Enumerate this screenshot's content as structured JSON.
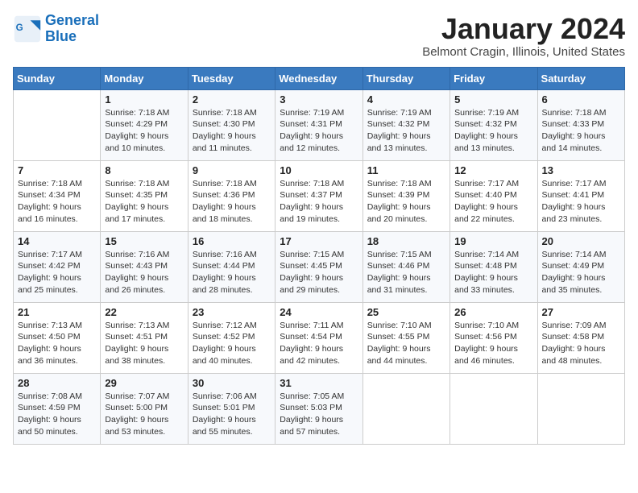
{
  "header": {
    "logo_line1": "General",
    "logo_line2": "Blue",
    "month": "January 2024",
    "location": "Belmont Cragin, Illinois, United States"
  },
  "weekdays": [
    "Sunday",
    "Monday",
    "Tuesday",
    "Wednesday",
    "Thursday",
    "Friday",
    "Saturday"
  ],
  "weeks": [
    [
      {
        "day": "",
        "sunrise": "",
        "sunset": "",
        "daylight": ""
      },
      {
        "day": "1",
        "sunrise": "7:18 AM",
        "sunset": "4:29 PM",
        "daylight": "9 hours and 10 minutes."
      },
      {
        "day": "2",
        "sunrise": "7:18 AM",
        "sunset": "4:30 PM",
        "daylight": "9 hours and 11 minutes."
      },
      {
        "day": "3",
        "sunrise": "7:19 AM",
        "sunset": "4:31 PM",
        "daylight": "9 hours and 12 minutes."
      },
      {
        "day": "4",
        "sunrise": "7:19 AM",
        "sunset": "4:32 PM",
        "daylight": "9 hours and 13 minutes."
      },
      {
        "day": "5",
        "sunrise": "7:19 AM",
        "sunset": "4:32 PM",
        "daylight": "9 hours and 13 minutes."
      },
      {
        "day": "6",
        "sunrise": "7:18 AM",
        "sunset": "4:33 PM",
        "daylight": "9 hours and 14 minutes."
      }
    ],
    [
      {
        "day": "7",
        "sunrise": "7:18 AM",
        "sunset": "4:34 PM",
        "daylight": "9 hours and 16 minutes."
      },
      {
        "day": "8",
        "sunrise": "7:18 AM",
        "sunset": "4:35 PM",
        "daylight": "9 hours and 17 minutes."
      },
      {
        "day": "9",
        "sunrise": "7:18 AM",
        "sunset": "4:36 PM",
        "daylight": "9 hours and 18 minutes."
      },
      {
        "day": "10",
        "sunrise": "7:18 AM",
        "sunset": "4:37 PM",
        "daylight": "9 hours and 19 minutes."
      },
      {
        "day": "11",
        "sunrise": "7:18 AM",
        "sunset": "4:39 PM",
        "daylight": "9 hours and 20 minutes."
      },
      {
        "day": "12",
        "sunrise": "7:17 AM",
        "sunset": "4:40 PM",
        "daylight": "9 hours and 22 minutes."
      },
      {
        "day": "13",
        "sunrise": "7:17 AM",
        "sunset": "4:41 PM",
        "daylight": "9 hours and 23 minutes."
      }
    ],
    [
      {
        "day": "14",
        "sunrise": "7:17 AM",
        "sunset": "4:42 PM",
        "daylight": "9 hours and 25 minutes."
      },
      {
        "day": "15",
        "sunrise": "7:16 AM",
        "sunset": "4:43 PM",
        "daylight": "9 hours and 26 minutes."
      },
      {
        "day": "16",
        "sunrise": "7:16 AM",
        "sunset": "4:44 PM",
        "daylight": "9 hours and 28 minutes."
      },
      {
        "day": "17",
        "sunrise": "7:15 AM",
        "sunset": "4:45 PM",
        "daylight": "9 hours and 29 minutes."
      },
      {
        "day": "18",
        "sunrise": "7:15 AM",
        "sunset": "4:46 PM",
        "daylight": "9 hours and 31 minutes."
      },
      {
        "day": "19",
        "sunrise": "7:14 AM",
        "sunset": "4:48 PM",
        "daylight": "9 hours and 33 minutes."
      },
      {
        "day": "20",
        "sunrise": "7:14 AM",
        "sunset": "4:49 PM",
        "daylight": "9 hours and 35 minutes."
      }
    ],
    [
      {
        "day": "21",
        "sunrise": "7:13 AM",
        "sunset": "4:50 PM",
        "daylight": "9 hours and 36 minutes."
      },
      {
        "day": "22",
        "sunrise": "7:13 AM",
        "sunset": "4:51 PM",
        "daylight": "9 hours and 38 minutes."
      },
      {
        "day": "23",
        "sunrise": "7:12 AM",
        "sunset": "4:52 PM",
        "daylight": "9 hours and 40 minutes."
      },
      {
        "day": "24",
        "sunrise": "7:11 AM",
        "sunset": "4:54 PM",
        "daylight": "9 hours and 42 minutes."
      },
      {
        "day": "25",
        "sunrise": "7:10 AM",
        "sunset": "4:55 PM",
        "daylight": "9 hours and 44 minutes."
      },
      {
        "day": "26",
        "sunrise": "7:10 AM",
        "sunset": "4:56 PM",
        "daylight": "9 hours and 46 minutes."
      },
      {
        "day": "27",
        "sunrise": "7:09 AM",
        "sunset": "4:58 PM",
        "daylight": "9 hours and 48 minutes."
      }
    ],
    [
      {
        "day": "28",
        "sunrise": "7:08 AM",
        "sunset": "4:59 PM",
        "daylight": "9 hours and 50 minutes."
      },
      {
        "day": "29",
        "sunrise": "7:07 AM",
        "sunset": "5:00 PM",
        "daylight": "9 hours and 53 minutes."
      },
      {
        "day": "30",
        "sunrise": "7:06 AM",
        "sunset": "5:01 PM",
        "daylight": "9 hours and 55 minutes."
      },
      {
        "day": "31",
        "sunrise": "7:05 AM",
        "sunset": "5:03 PM",
        "daylight": "9 hours and 57 minutes."
      },
      {
        "day": "",
        "sunrise": "",
        "sunset": "",
        "daylight": ""
      },
      {
        "day": "",
        "sunrise": "",
        "sunset": "",
        "daylight": ""
      },
      {
        "day": "",
        "sunrise": "",
        "sunset": "",
        "daylight": ""
      }
    ]
  ]
}
